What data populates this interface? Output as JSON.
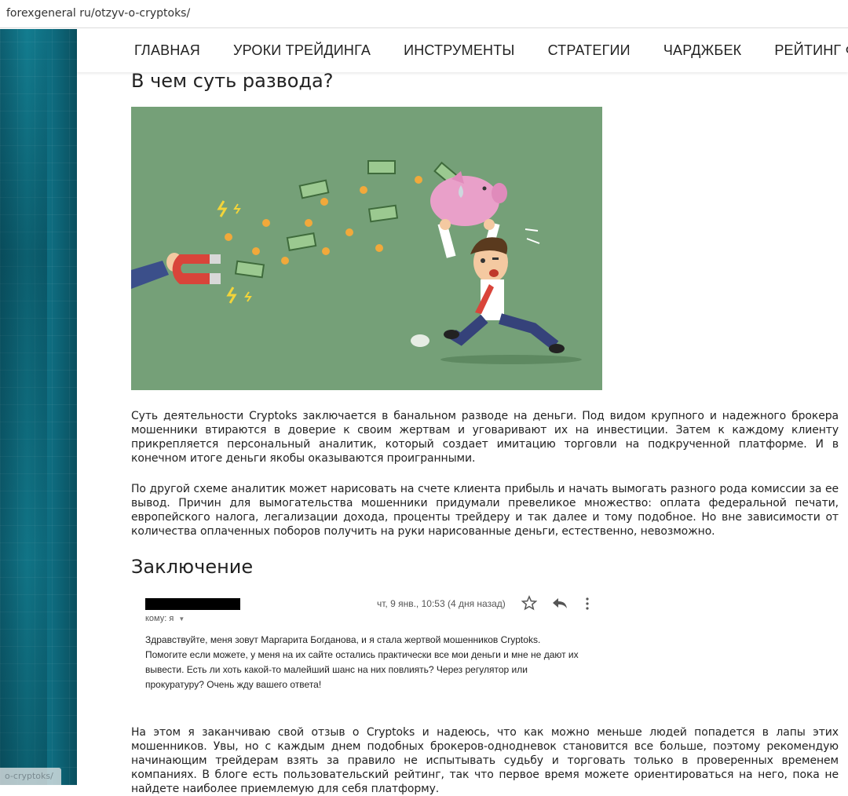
{
  "browser": {
    "url": "forexgeneral ru/otzyv-o-cryptoks/"
  },
  "status_tip": "o-cryptoks/",
  "nav": {
    "items": [
      {
        "label": "ГЛАВНАЯ"
      },
      {
        "label": "УРОКИ ТРЕЙДИНГА"
      },
      {
        "label": "ИНСТРУМЕНТЫ"
      },
      {
        "label": "СТРАТЕГИИ"
      },
      {
        "label": "ЧАРДЖБЕК"
      },
      {
        "label": "РЕЙТИНГ ФОРЕКС"
      }
    ]
  },
  "article": {
    "heading1": "В чем суть развода?",
    "para1": "Суть деятельности Cryptoks заключается в банальном разводе на деньги. Под видом крупного и надежного брокера мошенники втираются в доверие к своим жертвам и уговаривают их на инвестиции. Затем к каждому клиенту прикрепляется персональный аналитик, который создает имитацию торговли на подкрученной платформе. И в конечном итоге деньги якобы оказываются проигранными.",
    "para2": "По другой схеме аналитик может нарисовать на счете клиента прибыль и начать вымогать разного рода комиссии за ее вывод. Причин для вымогательства мошенники придумали превеликое множество: оплата федеральной печати, европейского налога, легализации дохода, проценты трейдеру и так далее и тому подобное. Но вне зависимости от количества оплаченных поборов получить на руки нарисованные деньги, естественно, невозможно.",
    "heading2": "Заключение",
    "para3": "На этом я заканчиваю свой отзыв о Cryptoks и надеюсь, что как можно меньше людей попадется в лапы этих мошенников. Увы, но с каждым днем подобных брокеров-однодневок становится все больше, поэтому рекомендую начинающим трейдерам взять за правило не испытывать судьбу и торговать только в проверенных временем компаниях. В блоге есть пользовательский рейтинг, так что первое время можете ориентироваться на него, пока не найдете наиболее приемлемую для себя платформу."
  },
  "email": {
    "date": "чт, 9 янв., 10:53 (4 дня назад)",
    "to": "кому: я",
    "body_lines": [
      "Здравствуйте, меня зовут Маргарита Богданова, и я стала жертвой мошенников Cryptoks.",
      "Помогите если можете, у меня на их сайте остались практически все мои деньги и мне не дают их",
      "вывести. Есть ли хоть какой-то малейший шанс на них повлиять? Через регулятор или",
      "прокуратуру? Очень жду вашего ответа!"
    ]
  },
  "colors": {
    "illustration_bg": "#75a078",
    "page_bg_left": "#137d90"
  }
}
